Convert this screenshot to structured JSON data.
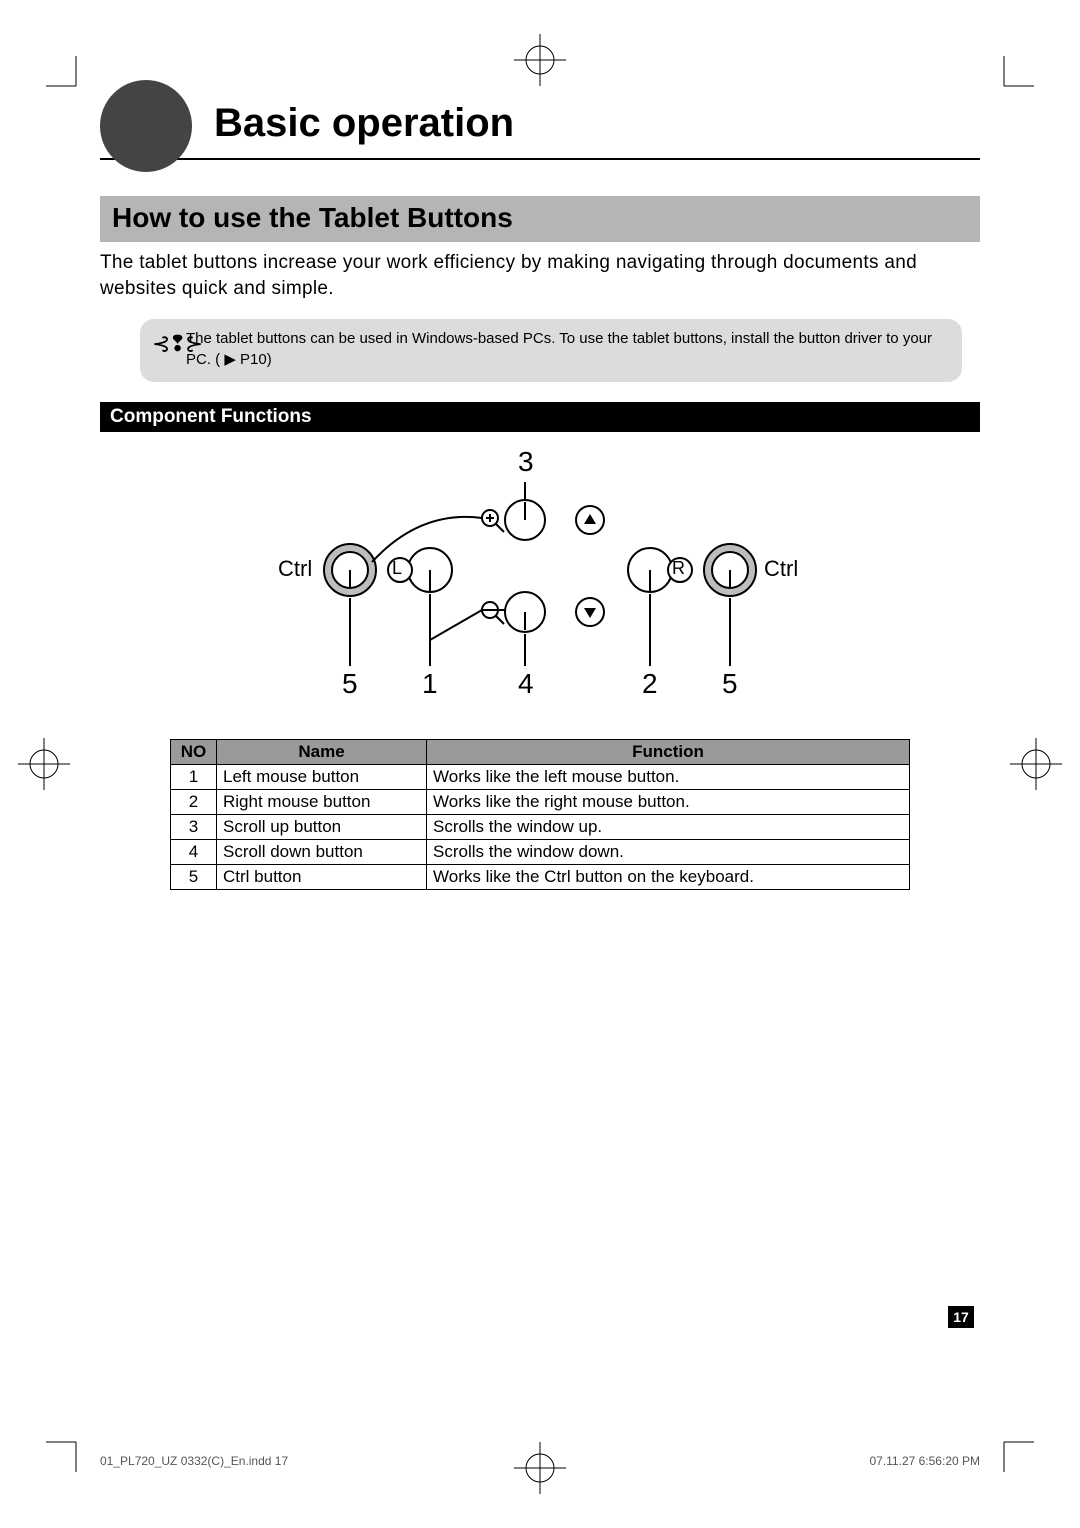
{
  "chapter_title": "Basic operation",
  "section_title": "How to use the Tablet Buttons",
  "lead_text": "The tablet buttons increase your work efficiency by making navigating through documents and websites quick and simple.",
  "note_text": "The tablet buttons can be used in Windows-based PCs. To use the tablet buttons, install the button driver to your PC. (",
  "note_ref": "▶ P10",
  "note_close": ")",
  "sub_heading": "Component Functions",
  "diagram": {
    "ctrl_left_label": "Ctrl",
    "ctrl_right_label": "Ctrl",
    "call_3": "3",
    "call_5a": "5",
    "call_1": "1",
    "call_4": "4",
    "call_2": "2",
    "call_5b": "5",
    "L": "L",
    "R": "R"
  },
  "table": {
    "head_no": "NO",
    "head_name": "Name",
    "head_fn": "Function",
    "rows": [
      {
        "no": "1",
        "name": "Left mouse button",
        "fn": "Works like the left mouse button."
      },
      {
        "no": "2",
        "name": "Right mouse button",
        "fn": "Works like the right mouse button."
      },
      {
        "no": "3",
        "name": "Scroll up button",
        "fn": "Scrolls the window up."
      },
      {
        "no": "4",
        "name": "Scroll down button",
        "fn": "Scrolls the window down."
      },
      {
        "no": "5",
        "name": "Ctrl button",
        "fn": "Works like the Ctrl button on the keyboard."
      }
    ]
  },
  "page_number": "17",
  "slug_left": "01_PL720_UZ 0332(C)_En.indd   17",
  "slug_right": "07.11.27   6:56:20 PM"
}
